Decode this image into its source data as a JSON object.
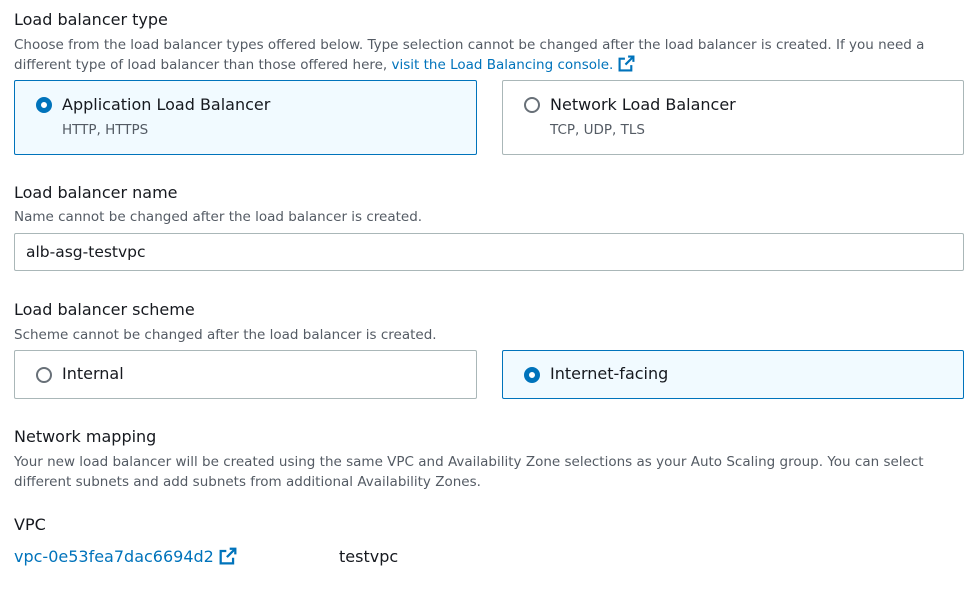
{
  "lb_type": {
    "label": "Load balancer type",
    "description_text": "Choose from the load balancer types offered below. Type selection cannot be changed after the load balancer is created. If you need a different type of load balancer than those offered here, ",
    "console_link": "visit the Load Balancing console.",
    "options": [
      {
        "title": "Application Load Balancer",
        "subtitle": "HTTP, HTTPS",
        "selected": true
      },
      {
        "title": "Network Load Balancer",
        "subtitle": "TCP, UDP, TLS",
        "selected": false
      }
    ]
  },
  "lb_name": {
    "label": "Load balancer name",
    "description": "Name cannot be changed after the load balancer is created.",
    "value": "alb-asg-testvpc"
  },
  "lb_scheme": {
    "label": "Load balancer scheme",
    "description": "Scheme cannot be changed after the load balancer is created.",
    "options": [
      {
        "title": "Internal",
        "selected": false
      },
      {
        "title": "Internet-facing",
        "selected": true
      }
    ]
  },
  "network_mapping": {
    "label": "Network mapping",
    "description": "Your new load balancer will be created using the same VPC and Availability Zone selections as your Auto Scaling group. You can select different subnets and add subnets from additional Availability Zones."
  },
  "vpc": {
    "label": "VPC",
    "id_link": "vpc-0e53fea7dac6694d2",
    "name": "testvpc"
  },
  "colors": {
    "accent": "#0073bb",
    "selected_bg": "#f1faff",
    "border": "#aab7b8",
    "secondary_text": "#545b64"
  }
}
